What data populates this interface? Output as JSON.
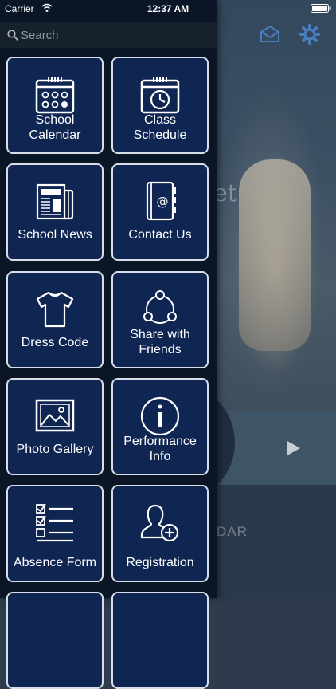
{
  "status_bar": {
    "carrier": "Carrier",
    "time": "12:37 AM"
  },
  "search": {
    "placeholder": "Search"
  },
  "background": {
    "hero_script": "et",
    "calendar_label": "DAR"
  },
  "menu": {
    "items": [
      {
        "label": "School\nCalendar",
        "icon": "calendar-icon"
      },
      {
        "label": "Class Schedule",
        "icon": "schedule-clock-icon"
      },
      {
        "label": "School News",
        "icon": "newspaper-icon"
      },
      {
        "label": "Contact Us",
        "icon": "address-book-icon"
      },
      {
        "label": "Dress Code",
        "icon": "shirt-icon"
      },
      {
        "label": "Share with\nFriends",
        "icon": "share-icon"
      },
      {
        "label": "Photo Gallery",
        "icon": "photo-icon"
      },
      {
        "label": "Performance\nInfo",
        "icon": "info-icon"
      },
      {
        "label": "Absence Form",
        "icon": "checklist-icon"
      },
      {
        "label": "Registration",
        "icon": "add-user-icon"
      }
    ]
  },
  "colors": {
    "tile_bg": "#0f2552",
    "tile_border": "#d8dde6",
    "drawer_bg": "#0a1626"
  }
}
